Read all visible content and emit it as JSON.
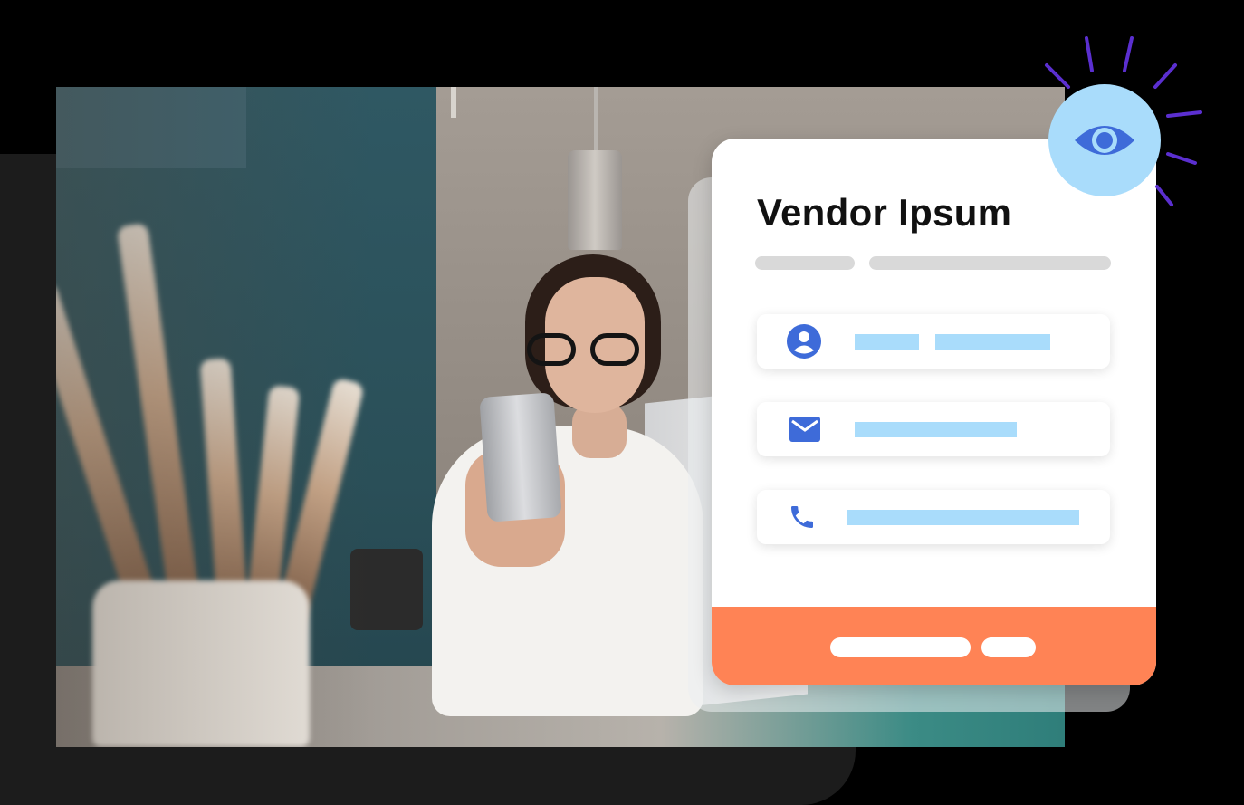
{
  "card": {
    "title": "Vendor Ipsum"
  },
  "icons": {
    "contact": "user-circle-icon",
    "email": "mail-icon",
    "phone": "phone-icon",
    "badge": "eye-icon"
  },
  "colors": {
    "accent": "#3e6bd9",
    "placeholder": "#a9dcfb",
    "footer": "#ff8355",
    "badge": "#a9dcfb",
    "rays": "#5b2fd0"
  }
}
